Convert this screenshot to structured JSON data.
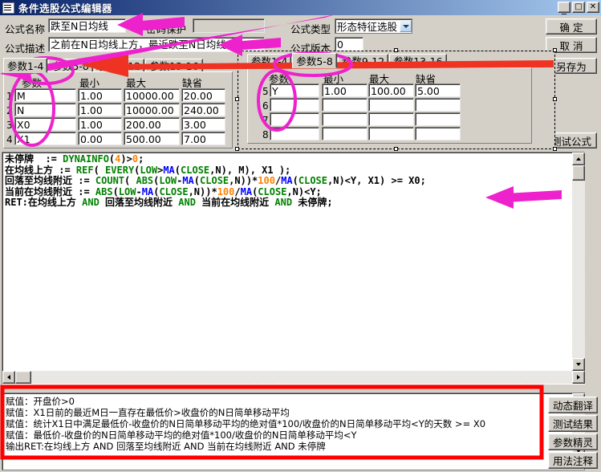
{
  "window": {
    "title": "条件选股公式编辑器",
    "icon": "document-icon",
    "controls": {
      "minimize": "_",
      "maximize": "□",
      "close": "✕"
    }
  },
  "form": {
    "name_label": "公式名称",
    "name_value": "跌至N日均线",
    "password_protect_label": "密码保护",
    "password_value": "",
    "desc_label": "公式描述",
    "desc_value": "之前在N日均线上方，最近跌至N日均线",
    "type_label": "公式类型",
    "type_value": "形态特征选股",
    "version_label": "公式版本",
    "version_value": "0"
  },
  "buttons": {
    "ok": "确 定",
    "cancel": "取 消",
    "save_as": "另存为",
    "test_formula": "测试公式",
    "dynamic_translate": "动态翻译",
    "test_result": "测试结果",
    "param_wizard": "参数精灵",
    "usage_note": "用法注释"
  },
  "params_back": {
    "tabs": [
      "参数1-4",
      "参数5-8",
      "参数9-12",
      "参数13-16"
    ],
    "selected_tab": 0,
    "headers": [
      "参数",
      "最小",
      "最大",
      "缺省"
    ],
    "rows": [
      {
        "no": "1",
        "name": "M",
        "min": "1.00",
        "max": "10000.00",
        "def": "20.00"
      },
      {
        "no": "2",
        "name": "N",
        "min": "1.00",
        "max": "10000.00",
        "def": "240.00"
      },
      {
        "no": "3",
        "name": "X0",
        "min": "1.00",
        "max": "200.00",
        "def": "3.00"
      },
      {
        "no": "4",
        "name": "X1",
        "min": "0.00",
        "max": "500.00",
        "def": "7.00"
      }
    ]
  },
  "params_front": {
    "tabs": [
      "参数1-4",
      "参数5-8",
      "参数9-12",
      "参数13-16"
    ],
    "selected_tab": 1,
    "headers": [
      "参数",
      "最小",
      "最大",
      "缺省"
    ],
    "rows": [
      {
        "no": "5",
        "name": "Y",
        "min": "1.00",
        "max": "100.00",
        "def": "5.00"
      },
      {
        "no": "6",
        "name": "",
        "min": "",
        "max": "",
        "def": ""
      },
      {
        "no": "7",
        "name": "",
        "min": "",
        "max": "",
        "def": ""
      },
      {
        "no": "8",
        "name": "",
        "min": "",
        "max": "",
        "def": ""
      }
    ]
  },
  "code_lines": [
    [
      {
        "t": "未停牌  := ",
        "c": "plain"
      },
      {
        "t": "DYNAINFO",
        "c": "fn"
      },
      {
        "t": "(",
        "c": "plain"
      },
      {
        "t": "4",
        "c": "num"
      },
      {
        "t": ")>",
        "c": "plain"
      },
      {
        "t": "0",
        "c": "num"
      },
      {
        "t": ";",
        "c": "plain"
      }
    ],
    [
      {
        "t": "在均线上方 := ",
        "c": "plain"
      },
      {
        "t": "REF",
        "c": "fn"
      },
      {
        "t": "( ",
        "c": "plain"
      },
      {
        "t": "EVERY",
        "c": "fn"
      },
      {
        "t": "(",
        "c": "plain"
      },
      {
        "t": "LOW",
        "c": "fn"
      },
      {
        "t": ">",
        "c": "plain"
      },
      {
        "t": "MA",
        "c": "var"
      },
      {
        "t": "(",
        "c": "plain"
      },
      {
        "t": "CLOSE",
        "c": "fn"
      },
      {
        "t": ",N), M), X1 );",
        "c": "plain"
      }
    ],
    [
      {
        "t": "回落至均线附近 := ",
        "c": "plain"
      },
      {
        "t": "COUNT",
        "c": "fn"
      },
      {
        "t": "( ",
        "c": "plain"
      },
      {
        "t": "ABS",
        "c": "fn"
      },
      {
        "t": "(",
        "c": "plain"
      },
      {
        "t": "LOW",
        "c": "fn"
      },
      {
        "t": "-",
        "c": "plain"
      },
      {
        "t": "MA",
        "c": "var"
      },
      {
        "t": "(",
        "c": "plain"
      },
      {
        "t": "CLOSE",
        "c": "fn"
      },
      {
        "t": ",N))*",
        "c": "plain"
      },
      {
        "t": "100",
        "c": "num"
      },
      {
        "t": "/",
        "c": "plain"
      },
      {
        "t": "MA",
        "c": "var"
      },
      {
        "t": "(",
        "c": "plain"
      },
      {
        "t": "CLOSE",
        "c": "fn"
      },
      {
        "t": ",N)<Y, X1) >= X0;",
        "c": "plain"
      }
    ],
    [
      {
        "t": "当前在均线附近 := ",
        "c": "plain"
      },
      {
        "t": "ABS",
        "c": "fn"
      },
      {
        "t": "(",
        "c": "plain"
      },
      {
        "t": "LOW",
        "c": "fn"
      },
      {
        "t": "-",
        "c": "plain"
      },
      {
        "t": "MA",
        "c": "var"
      },
      {
        "t": "(",
        "c": "plain"
      },
      {
        "t": "CLOSE",
        "c": "fn"
      },
      {
        "t": ",N))*",
        "c": "plain"
      },
      {
        "t": "100",
        "c": "num"
      },
      {
        "t": "/",
        "c": "plain"
      },
      {
        "t": "MA",
        "c": "var"
      },
      {
        "t": "(",
        "c": "plain"
      },
      {
        "t": "CLOSE",
        "c": "fn"
      },
      {
        "t": ",N)<Y;",
        "c": "plain"
      }
    ],
    [
      {
        "t": "RET:在均线上方 ",
        "c": "plain"
      },
      {
        "t": "AND",
        "c": "fn"
      },
      {
        "t": " 回落至均线附近 ",
        "c": "plain"
      },
      {
        "t": "AND",
        "c": "fn"
      },
      {
        "t": " 当前在均线附近 ",
        "c": "plain"
      },
      {
        "t": "AND",
        "c": "fn"
      },
      {
        "t": " 未停牌;",
        "c": "plain"
      }
    ]
  ],
  "output_lines": [
    "赋值：开盘价>0",
    "赋值：X1日前的最近M日一直存在最低价>收盘价的N日简单移动平均",
    "赋值：统计X1日中满足最低价-收盘价的N日简单移动平均的绝对值*100/收盘价的N日简单移动平均<Y的天数 >= X0",
    "赋值：最低价-收盘价的N日简单移动平均的绝对值*100/收盘价的N日简单移动平均<Y",
    "输出RET:在均线上方 AND 回落至均线附近 AND 当前在均线附近 AND 未停牌"
  ],
  "annotations": {
    "arrow_color": "#ee22cc",
    "bar_color": "#ee3322",
    "highlight_box_color": "#ff0000",
    "items": [
      "arrow-to-formula-name",
      "arrow-to-formula-desc",
      "arrow-to-formula-type",
      "ellipse-on-param-tab-back",
      "ellipse-on-param-name-column-back",
      "ellipse-on-param-tab-front",
      "ellipse-on-param-name-column-front",
      "red-bar-across-tabs",
      "arrow-to-code-area",
      "red-box-around-output"
    ]
  }
}
